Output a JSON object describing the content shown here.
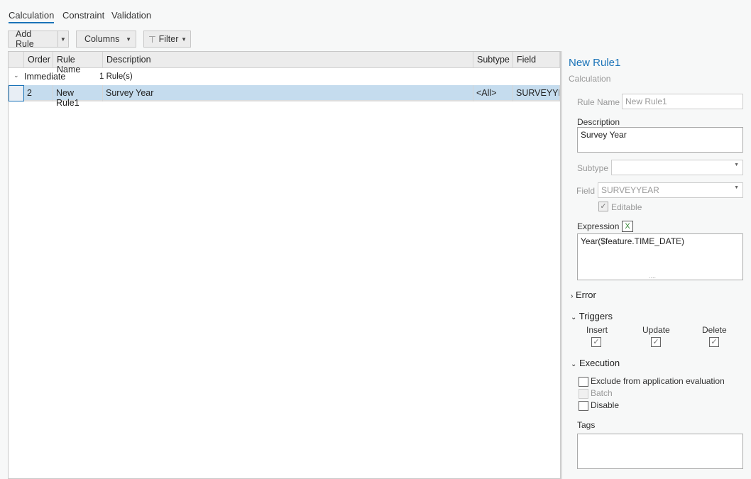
{
  "tabs": [
    {
      "label": "Calculation",
      "active": true
    },
    {
      "label": "Constraint"
    },
    {
      "label": "Validation"
    }
  ],
  "toolbar": {
    "add_rule": "Add Rule",
    "columns": "Columns",
    "filter": "Filter"
  },
  "grid": {
    "columns": [
      "Order",
      "Rule Name",
      "Description",
      "Subtype",
      "Field"
    ],
    "group": {
      "name": "Immediate",
      "count": "1 Rule(s)"
    },
    "rows": [
      {
        "order": "2",
        "name": "New Rule1",
        "description": "Survey Year",
        "subtype": "<All>",
        "field": "SURVEYYEA"
      }
    ]
  },
  "panel": {
    "title": "New Rule1",
    "subtitle": "Calculation",
    "rule_name_label": "Rule Name",
    "rule_name": "New Rule1",
    "description_label": "Description",
    "description": "Survey Year",
    "subtype_label": "Subtype",
    "subtype": "",
    "field_label": "Field",
    "field": "SURVEYYEAR",
    "editable_label": "Editable",
    "expression_label": "Expression",
    "expression": "Year($feature.TIME_DATE)",
    "error_label": "Error",
    "triggers_label": "Triggers",
    "triggers": [
      {
        "label": "Insert",
        "checked": true
      },
      {
        "label": "Update",
        "checked": true
      },
      {
        "label": "Delete",
        "checked": true
      }
    ],
    "execution_label": "Execution",
    "execution": [
      {
        "label": "Exclude from application evaluation",
        "checked": false
      },
      {
        "label": "Batch",
        "checked": false,
        "disabled": true
      },
      {
        "label": "Disable",
        "checked": false
      }
    ],
    "tags_label": "Tags"
  },
  "colors": {
    "accent": "#1a73b8",
    "selected_row": "#c5dcee"
  }
}
